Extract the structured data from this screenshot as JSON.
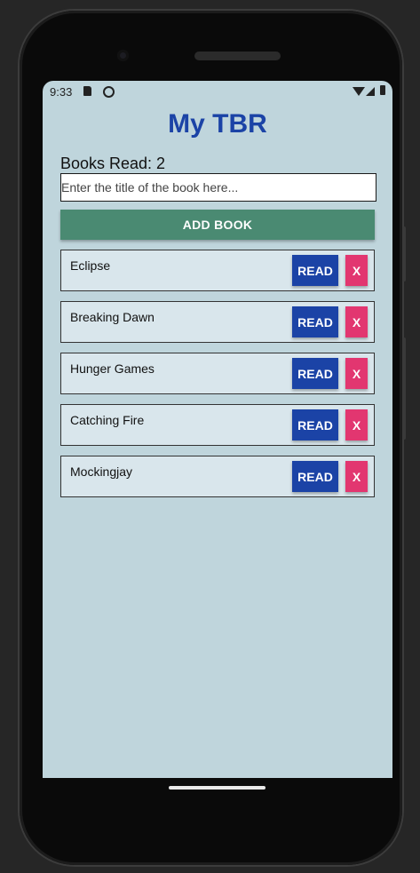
{
  "status_bar": {
    "time": "9:33"
  },
  "app": {
    "title": "My TBR",
    "books_read_label": "Books Read: 2",
    "input_placeholder": "Enter the title of the book here...",
    "add_button_label": "ADD BOOK"
  },
  "books": [
    {
      "title": "Eclipse",
      "read_label": "READ",
      "remove_label": "X"
    },
    {
      "title": "Breaking Dawn",
      "read_label": "READ",
      "remove_label": "X"
    },
    {
      "title": "Hunger Games",
      "read_label": "READ",
      "remove_label": "X"
    },
    {
      "title": "Catching Fire",
      "read_label": "READ",
      "remove_label": "X"
    },
    {
      "title": "Mockingjay",
      "read_label": "READ",
      "remove_label": "X"
    }
  ],
  "colors": {
    "background": "#bfd5dc",
    "title": "#1b43a6",
    "add_button": "#4a8a72",
    "read_button": "#1b43a6",
    "remove_button": "#e23670",
    "row_background": "#d9e6ec"
  },
  "icons": [
    "sd-card-icon",
    "sync-icon",
    "wifi-icon",
    "signal-icon",
    "battery-icon"
  ]
}
